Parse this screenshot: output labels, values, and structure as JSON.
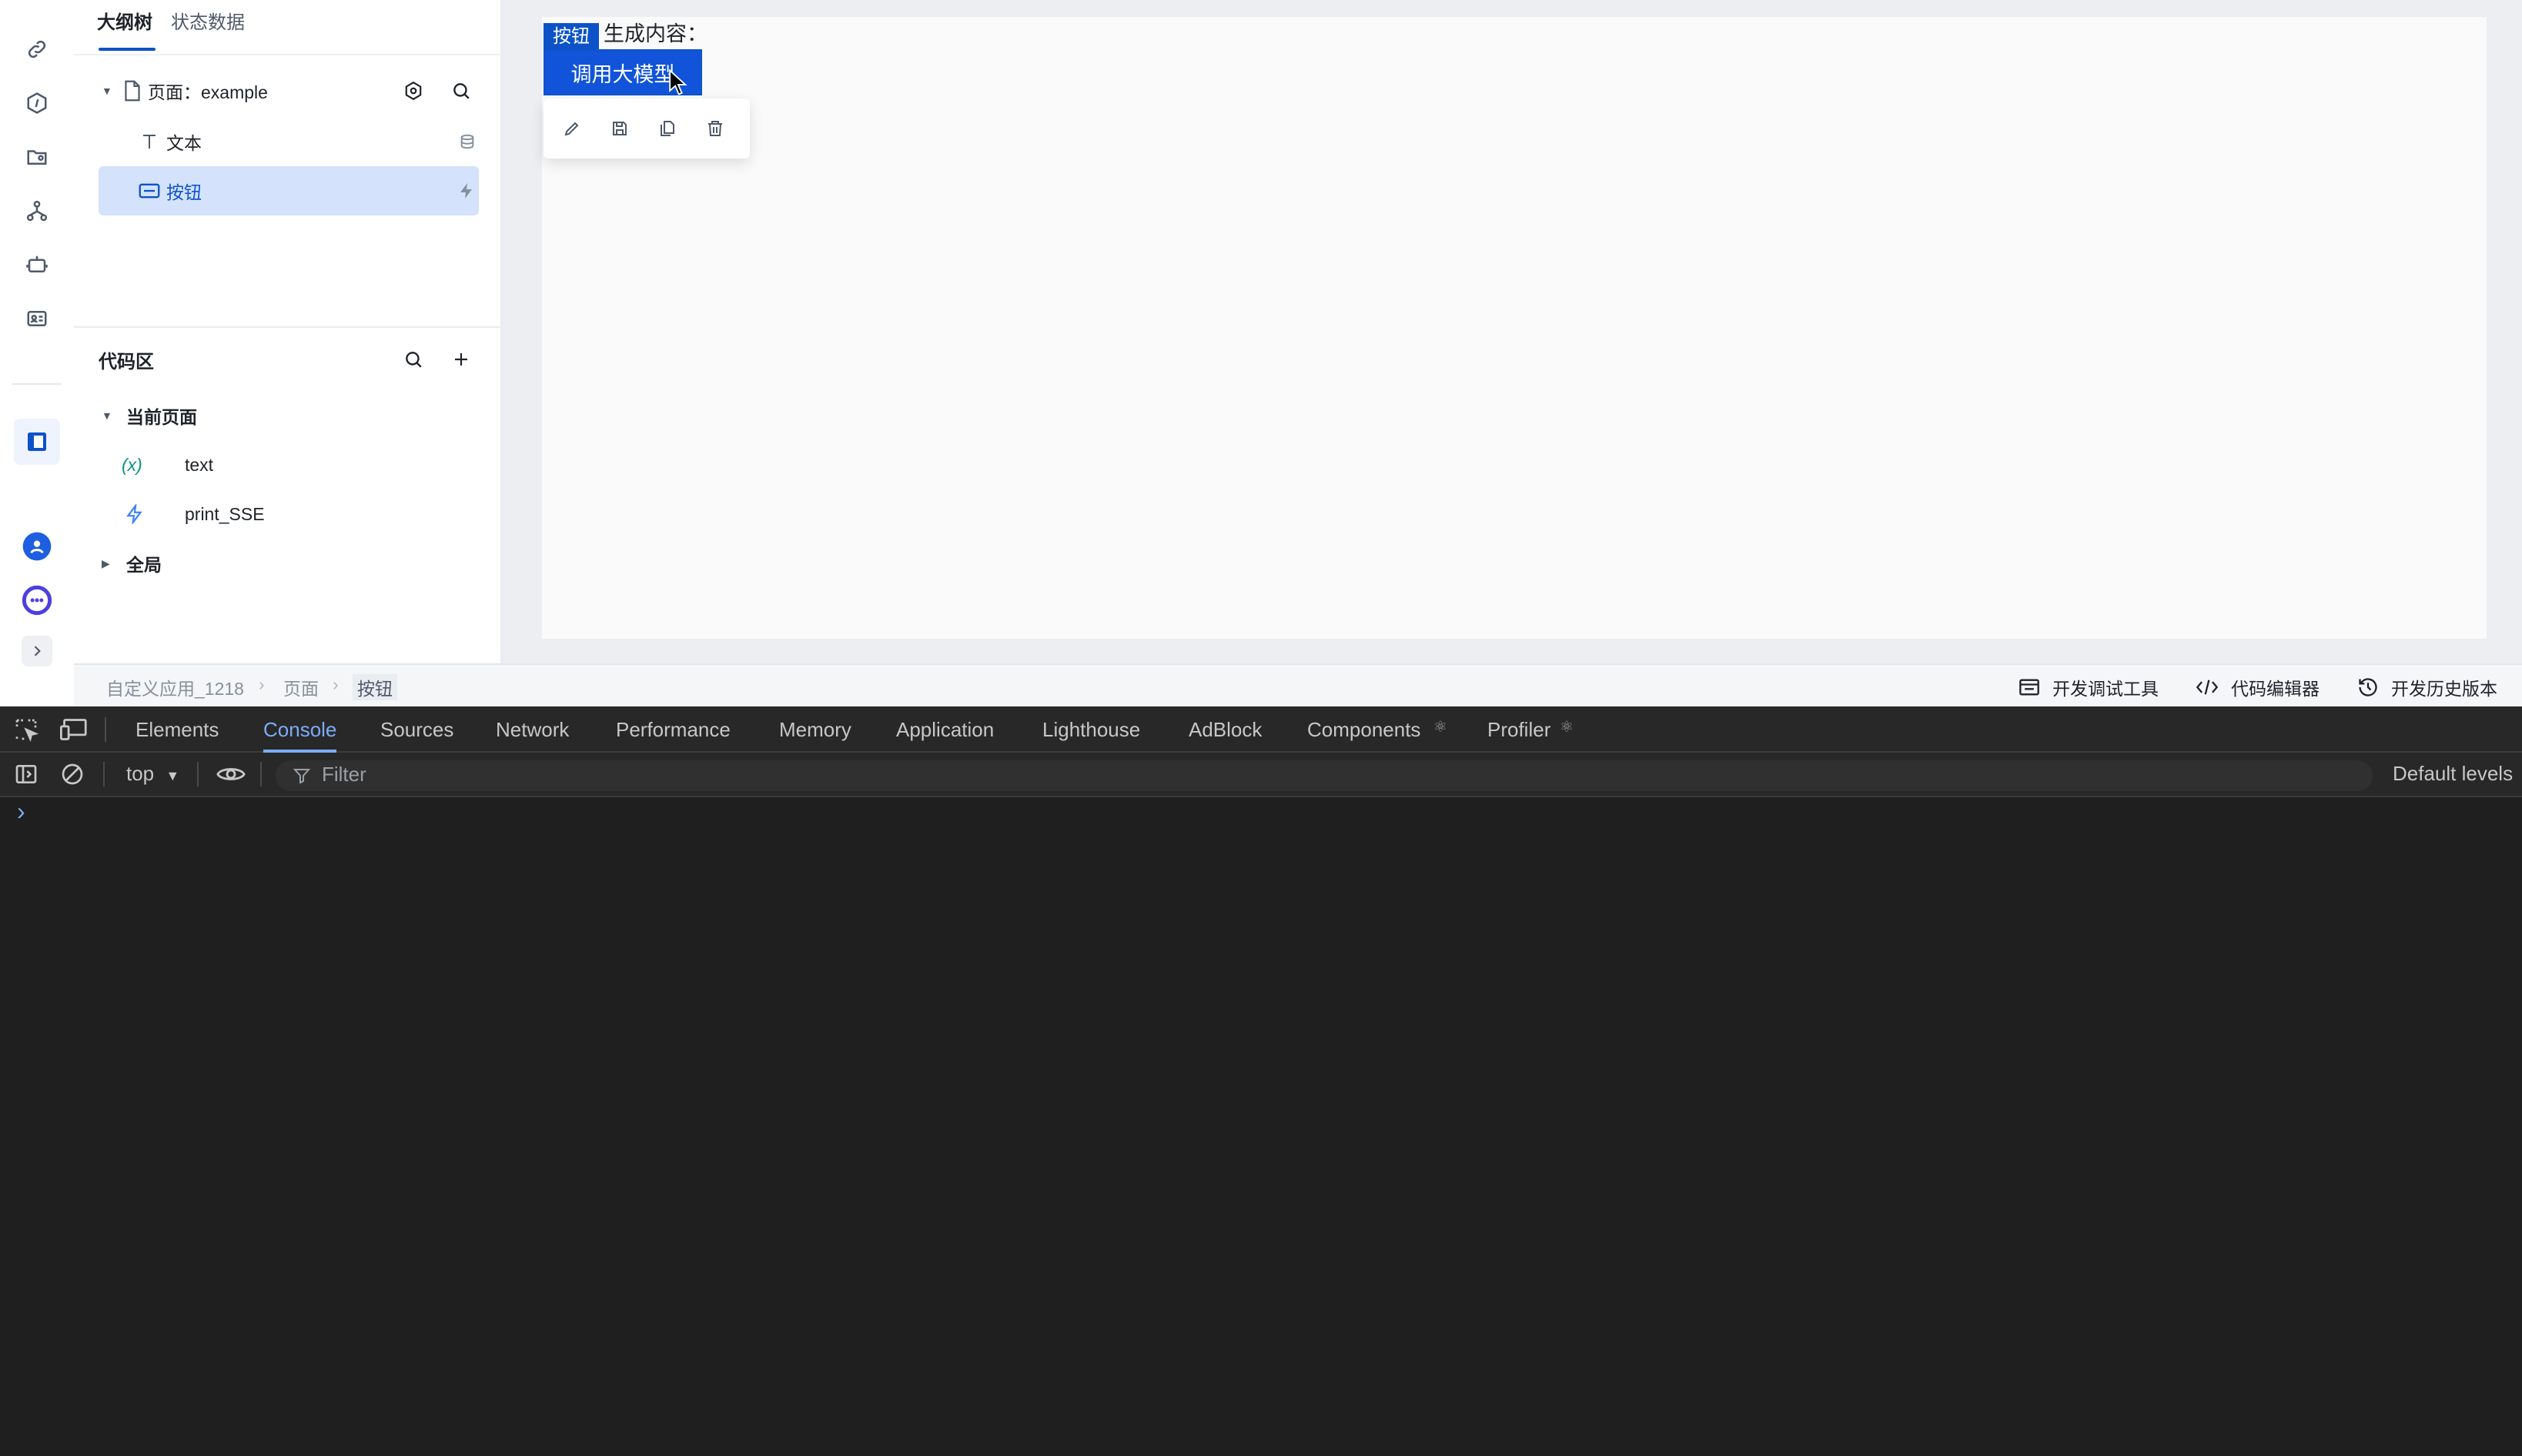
{
  "outline": {
    "tabs": [
      "大纲树",
      "状态数据"
    ],
    "tree": {
      "page_label": "页面：example",
      "items": [
        {
          "label": "文本"
        },
        {
          "label": "按钮"
        }
      ]
    }
  },
  "code_area": {
    "title": "代码区",
    "current_page_label": "当前页面",
    "items": [
      {
        "label": "text",
        "prefix": "(x)"
      },
      {
        "label": "print_SSE"
      }
    ],
    "global_label": "全局"
  },
  "canvas": {
    "generated_label": "生成内容：",
    "selected_tag": "按钮",
    "button_label": "调用大模型"
  },
  "status": {
    "breadcrumb": [
      "自定义应用_1218",
      "页面",
      "按钮"
    ],
    "links": [
      "开发调试工具",
      "代码编辑器",
      "开发历史版本"
    ]
  },
  "devtools": {
    "tabs": [
      "Elements",
      "Console",
      "Sources",
      "Network",
      "Performance",
      "Memory",
      "Application",
      "Lighthouse",
      "AdBlock",
      "Components",
      "Profiler"
    ],
    "active_tab": "Console",
    "context": "top",
    "filter_placeholder": "Filter",
    "levels": "Default levels",
    "prompt": "›"
  },
  "colors": {
    "accent": "#0d53c7",
    "selected_row": "#d4e2fb",
    "devtools_bg": "#1f1f1f"
  }
}
